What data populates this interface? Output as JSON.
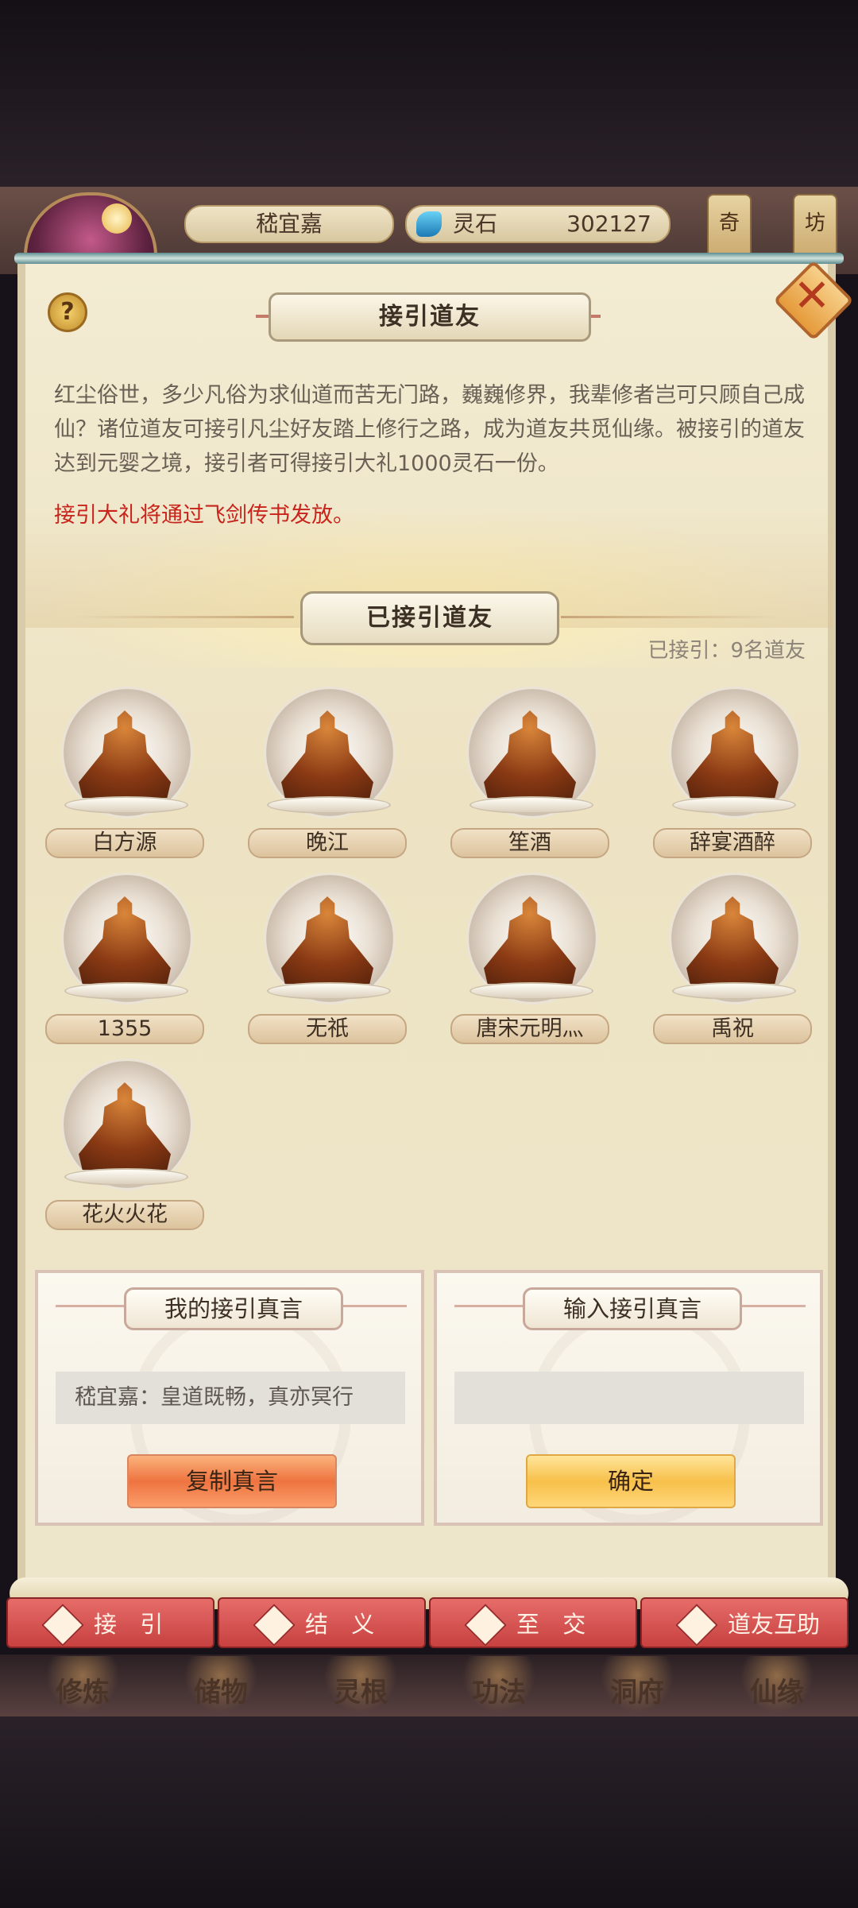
{
  "header": {
    "player_name": "嵇宜嘉",
    "currency_label": "灵石",
    "currency_value": "302127",
    "side_buttons": [
      "奇",
      "坊"
    ]
  },
  "dialog": {
    "title": "接引道友",
    "intro": "红尘俗世，多少凡俗为求仙道而苦无门路，巍巍修界，我辈修者岂可只顾自己成仙？诸位道友可接引凡尘好友踏上修行之路，成为道友共觅仙缘。被接引的道友达到元婴之境，接引者可得接引大礼1000灵石一份。",
    "notice": "接引大礼将通过飞剑传书发放。",
    "section_title": "已接引道友",
    "invite_count": "已接引：9名道友",
    "friends": [
      {
        "name": "白方源"
      },
      {
        "name": "晚江"
      },
      {
        "name": "笙酒"
      },
      {
        "name": "辞宴酒醉"
      },
      {
        "name": "1355"
      },
      {
        "name": "无祇"
      },
      {
        "name": "唐宋元明灬"
      },
      {
        "name": "禹祝"
      },
      {
        "name": "花火火花"
      }
    ],
    "my_code_card": {
      "title": "我的接引真言",
      "code": "嵇宜嘉：皇道既畅，真亦冥行",
      "button": "复制真言"
    },
    "input_code_card": {
      "title": "输入接引真言",
      "value": "",
      "placeholder": "",
      "button": "确定"
    }
  },
  "tabs": [
    "接 引",
    "结 义",
    "至 交",
    "道友互助"
  ],
  "main_nav": [
    "修炼",
    "储物",
    "灵根",
    "功法",
    "洞府",
    "仙缘"
  ],
  "colors": {
    "panel_bg": "#f3ecd3",
    "notice_red": "#c8241c",
    "tab_red": "#c7413f",
    "copy_button": "#ee7440",
    "confirm_button": "#f7c04a"
  }
}
